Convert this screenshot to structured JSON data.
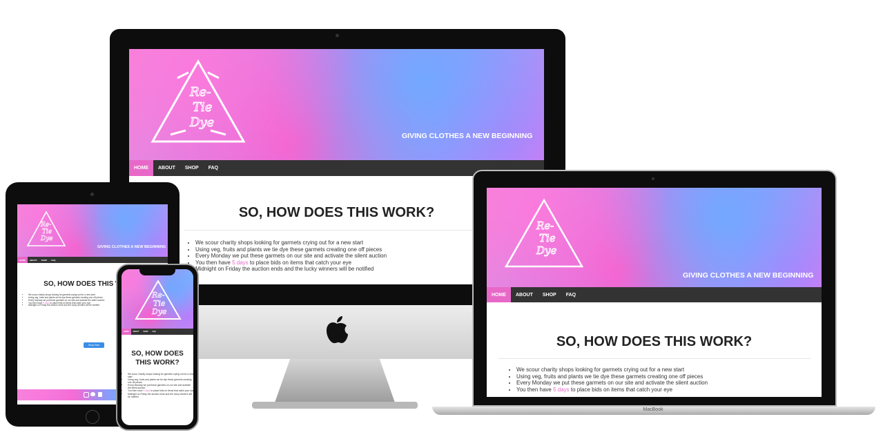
{
  "site": {
    "logo": {
      "line1": "Re-",
      "line2": "Tie",
      "line3": "Dye"
    },
    "tagline": "GIVING CLOTHES A NEW BEGINNING",
    "nav": [
      "HOME",
      "ABOUT",
      "SHOP",
      "FAQ"
    ],
    "section_title": "SO, HOW DOES THIS WORK?",
    "bullets": [
      "We scour charity shops looking for garmets crying out for a new start",
      "Using veg, fruits and plants we tie dye these garmets creating one off pieces",
      "Every Monday we put these garmets on our site and activate the silent auction",
      {
        "before": "You then have ",
        "highlight": "5 days",
        "after": " to place bids on items that catch your eye"
      },
      "Midnight on Friday the auction ends and the lucky winners will be notified"
    ],
    "cta_button": "Shop Now"
  },
  "devices": {
    "laptop_brand": "MacBook",
    "apple_logo": "apple-icon"
  },
  "colors": {
    "accent_pink": "#e868c8",
    "nav_bg": "#333333",
    "cta_blue": "#3a8ee6"
  }
}
